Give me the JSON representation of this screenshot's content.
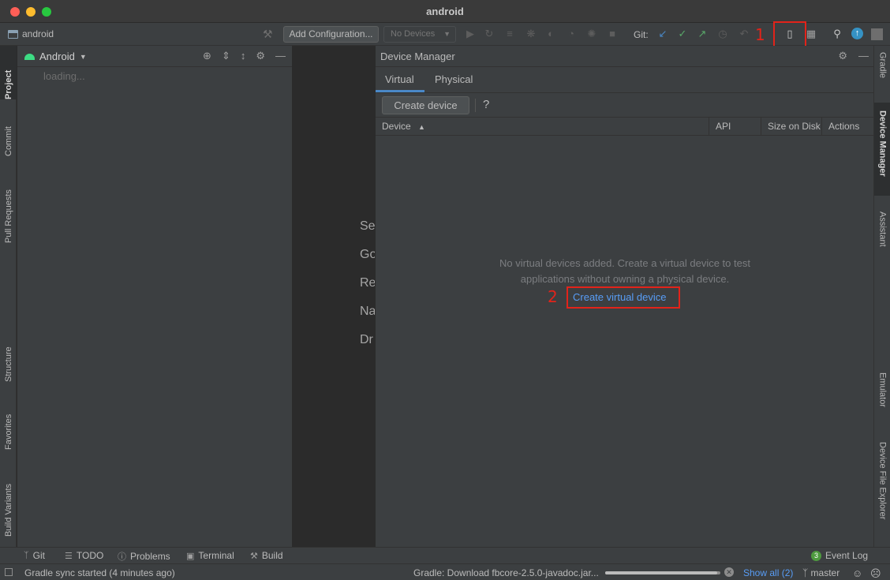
{
  "window": {
    "title": "android"
  },
  "navbar": {
    "project_name": "android",
    "add_configuration": "Add Configuration...",
    "device_selector": "No Devices",
    "git_label": "Git:"
  },
  "annotations": {
    "one": "1",
    "two": "2"
  },
  "left_tabs": [
    "Project",
    "Commit",
    "Pull Requests",
    "Structure",
    "Favorites",
    "Build Variants"
  ],
  "right_tabs": [
    "Gradle",
    "Device Manager",
    "Assistant",
    "Emulator",
    "Device File Explorer"
  ],
  "project_panel": {
    "view": "Android",
    "loading": "loading..."
  },
  "editor_tips": [
    "Se",
    "Go",
    "Re",
    "Na",
    "Dr"
  ],
  "device_manager": {
    "title": "Device Manager",
    "tabs": [
      "Virtual",
      "Physical"
    ],
    "active_tab": "Virtual",
    "create_device": "Create device",
    "help": "?",
    "columns": [
      "Device",
      "API",
      "Size on Disk",
      "Actions"
    ],
    "sort_column": "Device",
    "empty_line1": "No virtual devices added. Create a virtual device to test",
    "empty_line2": "applications without owning a physical device.",
    "create_virtual_device": "Create virtual device"
  },
  "bottom_tools": [
    "Git",
    "TODO",
    "Problems",
    "Terminal",
    "Build"
  ],
  "event_log": {
    "count": "3",
    "label": "Event Log"
  },
  "status": {
    "message": "Gradle sync started (4 minutes ago)",
    "task": "Gradle: Download fbcore-2.5.0-javadoc.jar...",
    "show_all": "Show all (2)",
    "branch": "master",
    "progress_fraction": 0.97
  },
  "colors": {
    "accent": "#4a88c7",
    "link": "#589df6",
    "highlight": "#e2231a"
  }
}
